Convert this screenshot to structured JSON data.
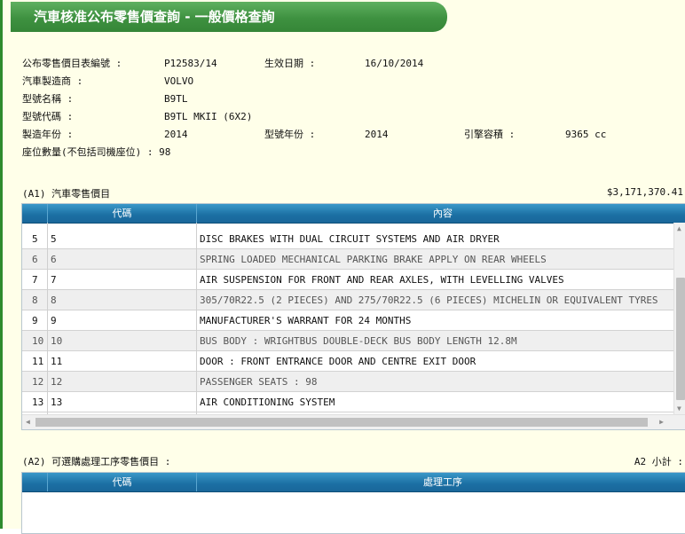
{
  "page_title": "汽車核准公布零售價查詢 - 一般價格查詢",
  "info": {
    "list_no_label": "公布零售價目表編號 :",
    "list_no": "P12583/14",
    "effective_label": "生效日期 :",
    "effective_date": "16/10/2014",
    "maker_label": "汽車製造商 :",
    "maker": "VOLVO",
    "model_name_label": "型號名稱 :",
    "model_name": "B9TL",
    "model_code_label": "型號代碼 :",
    "model_code": "B9TL MKII (6X2)",
    "manu_year_label": "製造年份 :",
    "manu_year": "2014",
    "model_year_label": "型號年份 :",
    "model_year": "2014",
    "engine_label": "引擎容積 :",
    "engine": "9365 cc",
    "seats_label": "座位數量(不包括司機座位) : 98"
  },
  "a1": {
    "label": "(A1) 汽車零售價目",
    "amount": "$3,171,370.41",
    "col_code": "代碼",
    "col_content": "內容",
    "rows": [
      {
        "idx": "5",
        "code": "5",
        "content": "DISC BRAKES WITH DUAL CIRCUIT SYSTEMS AND AIR DRYER"
      },
      {
        "idx": "6",
        "code": "6",
        "content": "SPRING LOADED MECHANICAL PARKING BRAKE APPLY ON REAR WHEELS"
      },
      {
        "idx": "7",
        "code": "7",
        "content": "AIR SUSPENSION FOR FRONT AND REAR AXLES, WITH LEVELLING VALVES"
      },
      {
        "idx": "8",
        "code": "8",
        "content": "305/70R22.5 (2 PIECES) AND 275/70R22.5 (6 PIECES) MICHELIN OR EQUIVALENT TYRES"
      },
      {
        "idx": "9",
        "code": "9",
        "content": "MANUFACTURER'S WARRANT FOR 24 MONTHS"
      },
      {
        "idx": "10",
        "code": "10",
        "content": "BUS BODY : WRIGHTBUS DOUBLE-DECK BUS BODY LENGTH 12.8M"
      },
      {
        "idx": "11",
        "code": "11",
        "content": "DOOR : FRONT ENTRANCE DOOR AND CENTRE EXIT DOOR"
      },
      {
        "idx": "12",
        "code": "12",
        "content": "PASSENGER SEATS : 98"
      },
      {
        "idx": "13",
        "code": "13",
        "content": "AIR CONDITIONING SYSTEM"
      }
    ]
  },
  "a2": {
    "label": "(A2) 可選購處理工序零售價目 :",
    "subtotal_label": "A2 小計 :",
    "col_code": "代碼",
    "col_process": "處理工序"
  }
}
